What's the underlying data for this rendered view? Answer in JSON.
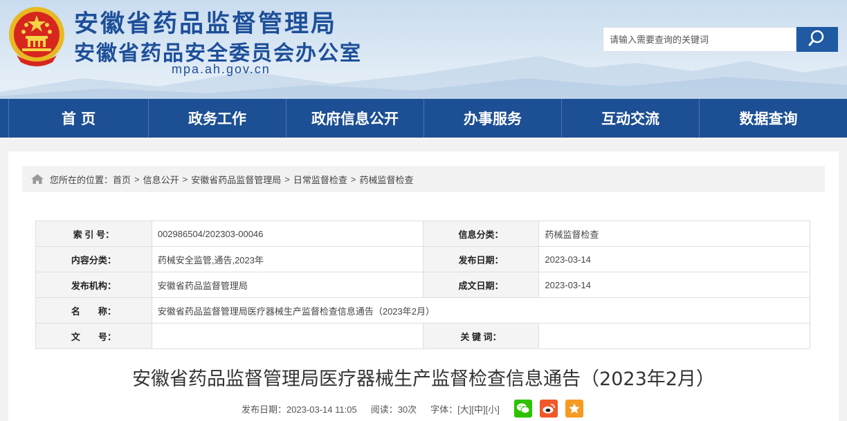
{
  "header": {
    "title_main": "安徽省药品监督管理局",
    "title_sub": "安徽省药品安全委员会办公室",
    "domain": "mpa.ah.gov.cn"
  },
  "search": {
    "placeholder": "请输入需要查询的关键词",
    "icon": "search-icon"
  },
  "nav": {
    "items": [
      "首 页",
      "政务工作",
      "政府信息公开",
      "办事服务",
      "互动交流",
      "数据查询"
    ]
  },
  "breadcrumb": {
    "prefix": "您所在的位置：",
    "items": [
      "首页",
      "信息公开",
      "安徽省药品监督管理局",
      "日常监督检查",
      "药械监督检查"
    ],
    "separator": ">"
  },
  "meta": {
    "index_label": "索 引 号：",
    "index_value": "002986504/202303-00046",
    "info_cat_label": "信息分类：",
    "info_cat_value": "药械监督检查",
    "content_cat_label": "内容分类：",
    "content_cat_value": "药械安全监管,通告,2023年",
    "publish_date_label": "发布日期：",
    "publish_date_value": "2023-03-14",
    "org_label": "发布机构：",
    "org_value": "安徽省药品监督管理局",
    "doc_date_label": "成文日期：",
    "doc_date_value": "2023-03-14",
    "name_label": "名　　称：",
    "name_value": "安徽省药品监督管理局医疗器械生产监督检查信息通告（2023年2月）",
    "docno_label": "文　　号：",
    "docno_value": "",
    "keywords_label": "关 键 词：",
    "keywords_value": ""
  },
  "article": {
    "title": "安徽省药品监督管理局医疗器械生产监督检查信息通告（2023年2月）",
    "publish_text": "发布日期：2023-03-14 11:05",
    "reads_text": "阅读：30次",
    "font_label": "字体：",
    "font_large": "[大]",
    "font_medium": "[中]",
    "font_small": "[小]"
  },
  "share": {
    "wechat_color": "#2dc100",
    "weibo_color": "#f0582a",
    "favorite_color": "#f59a23"
  },
  "colors": {
    "brand": "#1d4f99",
    "nav_bg": "#1c4f93"
  }
}
